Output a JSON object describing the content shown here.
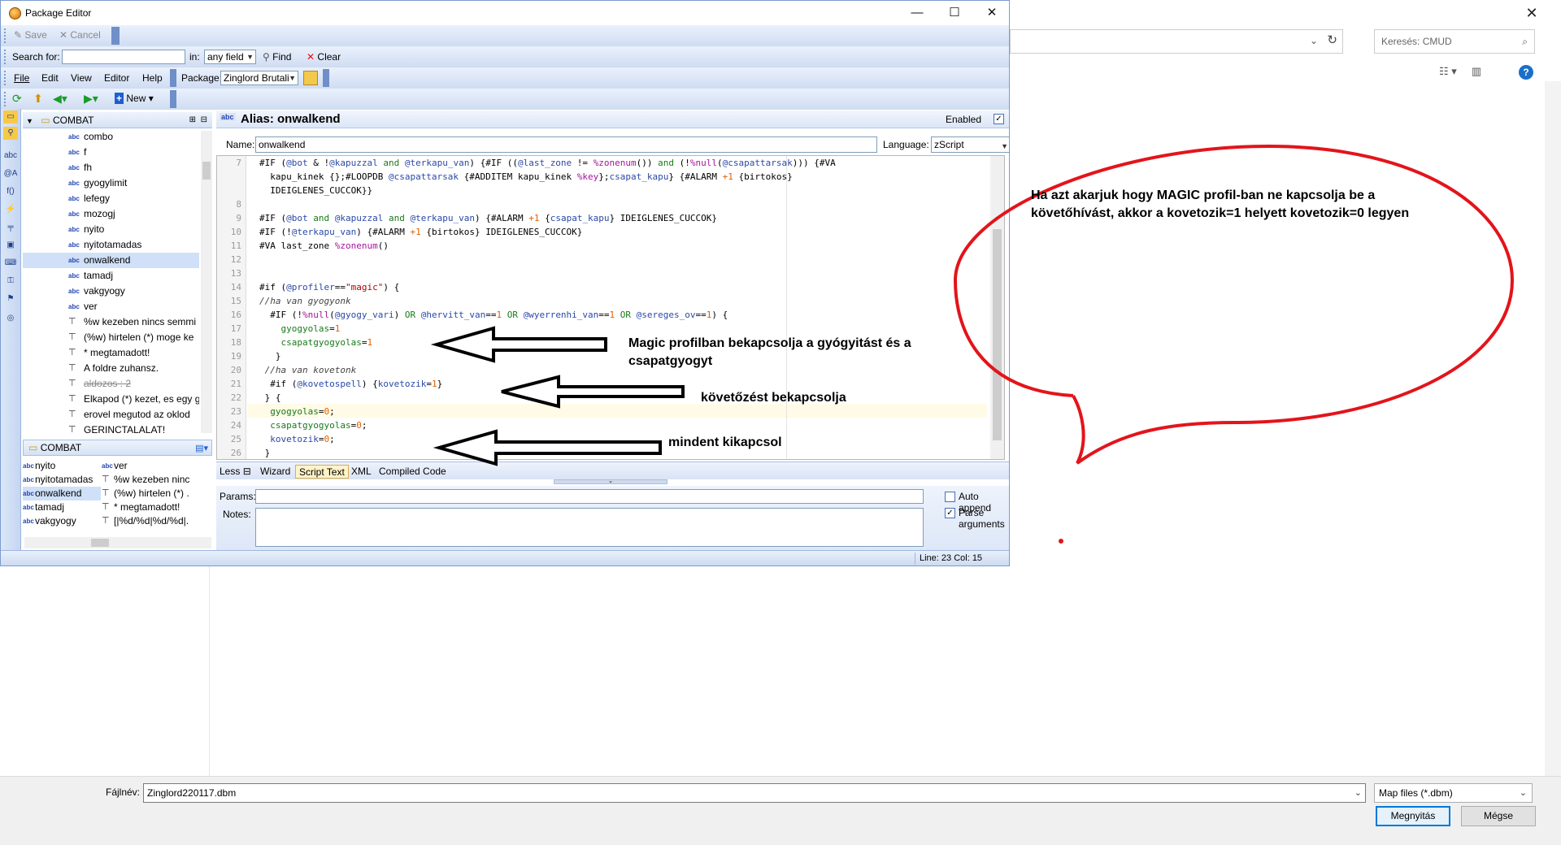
{
  "background_dialog": {
    "search_placeholder": "Keresés: CMUD",
    "filename_label": "Fájlnév:",
    "filename_value": "Zinglord220117.dbm",
    "filetype_value": "Map files (*.dbm)",
    "open_button": "Megnyitás",
    "cancel_button": "Mégse"
  },
  "window": {
    "title": "Package Editor"
  },
  "toolbar1": {
    "save": "Save",
    "cancel": "Cancel"
  },
  "searchbar": {
    "search_label": "Search for:",
    "in_label": "in:",
    "field_value": "any field",
    "find": "Find",
    "clear": "Clear"
  },
  "menubar": {
    "items": [
      "File",
      "Edit",
      "View",
      "Editor",
      "Help"
    ],
    "package_label": "Package:",
    "package_value": "Zinglord Brutali"
  },
  "toolbar3": {
    "new": "New"
  },
  "tree": {
    "folder": "COMBAT",
    "items": [
      {
        "type": "abc",
        "label": "combo"
      },
      {
        "type": "abc",
        "label": "f"
      },
      {
        "type": "abc",
        "label": "fh"
      },
      {
        "type": "abc",
        "label": "gyogylimit"
      },
      {
        "type": "abc",
        "label": "lefegy"
      },
      {
        "type": "abc",
        "label": "mozogj"
      },
      {
        "type": "abc",
        "label": "nyito"
      },
      {
        "type": "abc",
        "label": "nyitotamadas"
      },
      {
        "type": "abc",
        "label": "onwalkend"
      },
      {
        "type": "abc",
        "label": "tamadj"
      },
      {
        "type": "abc",
        "label": "vakgyogy"
      },
      {
        "type": "abc",
        "label": "ver"
      },
      {
        "type": "trig",
        "label": "%w kezeben nincs semmi"
      },
      {
        "type": "trig",
        "label": "(%w) hirtelen (*) moge ke"
      },
      {
        "type": "trig",
        "label": "* megtamadott!"
      },
      {
        "type": "trig",
        "label": "A foldre zuhansz."
      },
      {
        "type": "trig",
        "label": "aldozos : 2"
      },
      {
        "type": "trig",
        "label": "Elkapod (*) kezet, es egy g"
      },
      {
        "type": "trig",
        "label": "erovel megutod az oklod"
      },
      {
        "type": "trig",
        "label": "GERINCTALALAT!"
      }
    ]
  },
  "lower_panel": {
    "folder": "COMBAT",
    "left_items": [
      "nyito",
      "nyitotamadas",
      "onwalkend",
      "tamadj",
      "vakgyogy"
    ],
    "right_items": [
      "ver",
      "%w kezeben ninc",
      "(%w) hirtelen (*) .",
      "* megtamadott!",
      "[|%d/%d|%d/%d|."
    ]
  },
  "editor": {
    "header": "Alias: onwalkend",
    "enabled_label": "Enabled",
    "name_label": "Name:",
    "name_value": "onwalkend",
    "language_label": "Language:",
    "language_value": "zScript",
    "line_numbers": [
      "7",
      "",
      "",
      "8",
      "9",
      "10",
      "11",
      "12",
      "13",
      "14",
      "15",
      "16",
      "17",
      "18",
      "19",
      "20",
      "21",
      "22",
      "23",
      "24",
      "25",
      "26"
    ],
    "tabs": {
      "less": "Less",
      "wizard": "Wizard",
      "script_text": "Script Text",
      "xml": "XML",
      "compiled": "Compiled Code"
    },
    "params_label": "Params:",
    "notes_label": "Notes:",
    "auto_append": "Auto append",
    "parse_arguments": "Parse arguments"
  },
  "status": {
    "position": "Line: 23 Col: 15"
  },
  "annotations": {
    "bubble_text": "Ha azt akarjuk hogy MAGIC profil-ban ne kapcsolja be a követőhívást, akkor a kovetozik=1 helyett kovetozik=0 legyen",
    "arrow1": "Magic profilban bekapcsolja a gyógyitást és a csapatgyogyt",
    "arrow2": "követőzést bekapcsolja",
    "arrow3": "mindent kikapcsol",
    "red_color": "#e3141b"
  }
}
